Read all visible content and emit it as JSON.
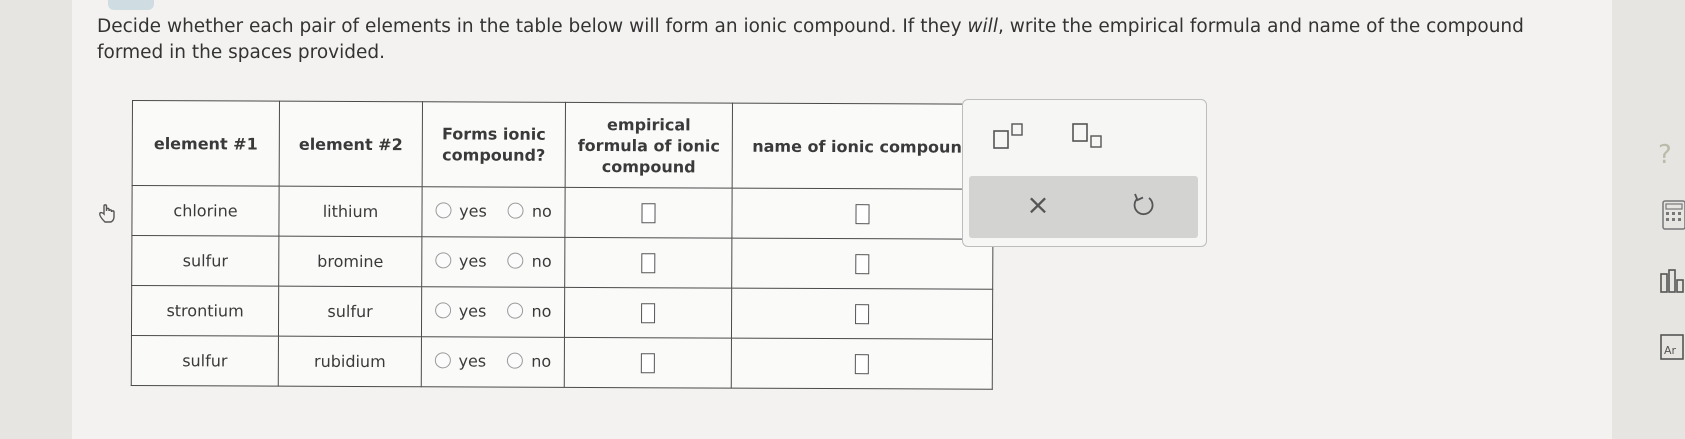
{
  "question": {
    "part1": "Decide whether each pair of elements in the table below will form an ionic compound. If they ",
    "emph": "will",
    "part2": ", write the empirical formula and name of the compound formed in the spaces provided."
  },
  "table": {
    "headers": {
      "element1": "element #1",
      "element2": "element #2",
      "forms_line1": "Forms ionic",
      "forms_line2": "compound?",
      "formula_line1": "empirical",
      "formula_line2": "formula of ionic",
      "formula_line3": "compound",
      "name": "name of ionic compound"
    },
    "rows": [
      {
        "element1": "chlorine",
        "element2": "lithium",
        "yes": "yes",
        "no": "no"
      },
      {
        "element1": "sulfur",
        "element2": "bromine",
        "yes": "yes",
        "no": "no"
      },
      {
        "element1": "strontium",
        "element2": "sulfur",
        "yes": "yes",
        "no": "no"
      },
      {
        "element1": "sulfur",
        "element2": "rubidium",
        "yes": "yes",
        "no": "no"
      }
    ]
  },
  "tools": {
    "clear_symbol": "×",
    "side_help": "?"
  },
  "icons": {
    "pointer": "hand-pointer-icon",
    "superscript": "superscript-icon",
    "subscript": "subscript-icon",
    "undo": "undo-icon",
    "calculator": "calculator-icon",
    "data": "bar-chart-icon",
    "periodic": "periodic-table-icon"
  },
  "colors": {
    "page": "#f3f2f0",
    "toolbar": "#d3d3d2",
    "grid_border": "#4a4a4a"
  }
}
